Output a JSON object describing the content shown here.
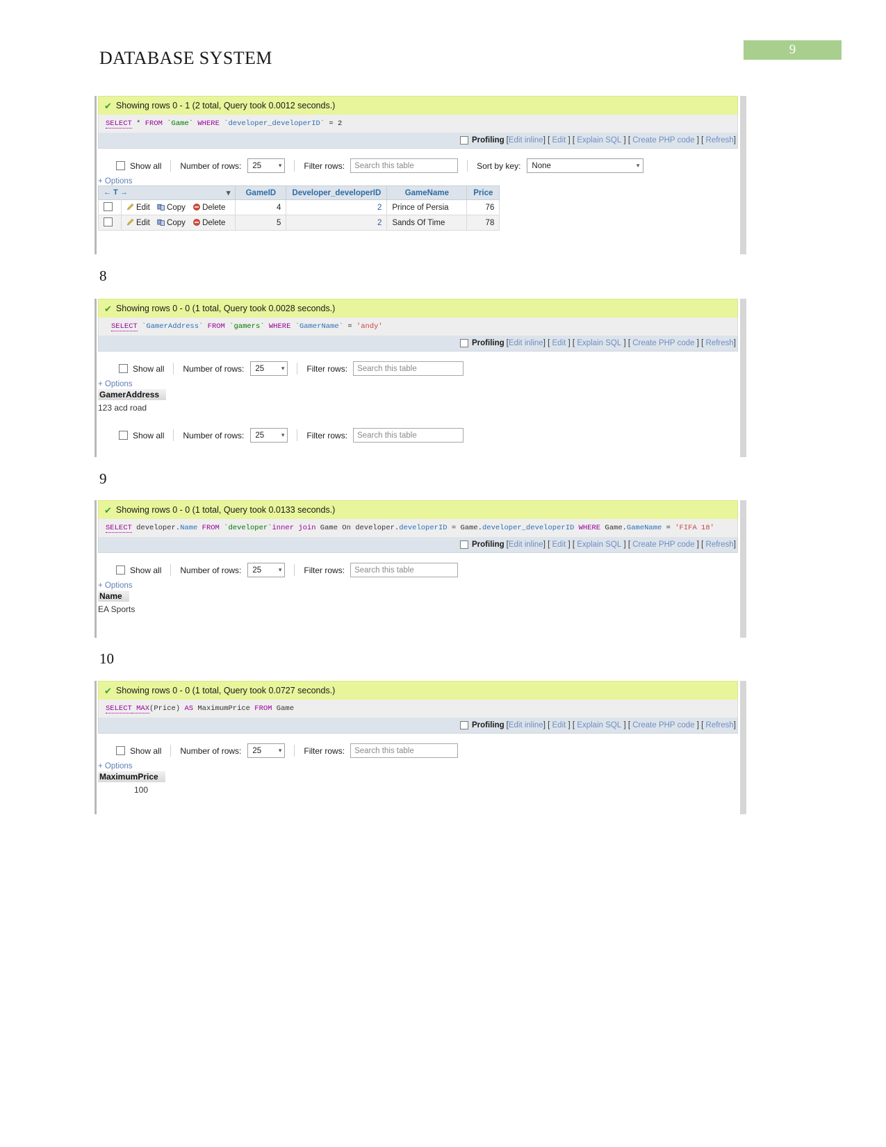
{
  "document": {
    "title": "DATABASE SYSTEM",
    "page_badge": "9"
  },
  "common": {
    "check_icon": "check-icon",
    "profiling_label": "Profiling",
    "links": {
      "edit_inline": "Edit inline",
      "edit": "Edit",
      "explain_sql": "Explain SQL",
      "create_php": "Create PHP code",
      "refresh": "Refresh"
    },
    "brackets": {
      "open": "[",
      "close": "]"
    },
    "controls": {
      "show_all": "Show all",
      "number_of_rows_label": "Number of rows:",
      "number_of_rows_value": "25",
      "filter_rows_label": "Filter rows:",
      "filter_placeholder": "Search this table",
      "sort_by_key_label": "Sort by key:",
      "sort_by_key_value": "None",
      "options": "+ Options"
    },
    "colors": {
      "success_bg": "#e8f59b",
      "badge_green": "#a8cf8e",
      "profiling_bg": "#dde3ea",
      "link_blue": "#6d8fc4"
    }
  },
  "panels": [
    {
      "id": "panel-7",
      "section_number": null,
      "status": "Showing rows 0 - 1 (2 total, Query took 0.0012 seconds.)",
      "sql_tokens": [
        {
          "t": "SELECT",
          "c": "kw-u"
        },
        {
          "t": " * ",
          "c": "plain"
        },
        {
          "t": "FROM",
          "c": "kw"
        },
        {
          "t": " `Game` ",
          "c": "tbl"
        },
        {
          "t": "WHERE",
          "c": "kw"
        },
        {
          "t": " `developer_developerID` ",
          "c": "col"
        },
        {
          "t": "= 2",
          "c": "num"
        }
      ],
      "has_sort_by_key": true,
      "result_type": "table",
      "table": {
        "nav_cell": "← T →",
        "headers": [
          "GameID",
          "Developer_developerID",
          "GameName",
          "Price"
        ],
        "row_actions": [
          "Edit",
          "Copy",
          "Delete"
        ],
        "rows": [
          {
            "GameID": "4",
            "Developer_developerID": "2",
            "GameName": "Prince of Persia",
            "Price": "76"
          },
          {
            "GameID": "5",
            "Developer_developerID": "2",
            "GameName": "Sands Of Time",
            "Price": "78"
          }
        ]
      }
    },
    {
      "id": "panel-8",
      "section_number": "8",
      "status": "Showing rows 0 - 0 (1 total, Query took 0.0028 seconds.)",
      "sql_tokens": [
        {
          "t": "SELECT",
          "c": "kw-u"
        },
        {
          "t": " `GamerAddress` ",
          "c": "col"
        },
        {
          "t": "FROM",
          "c": "kw"
        },
        {
          "t": " `gamers` ",
          "c": "tbl"
        },
        {
          "t": "WHERE",
          "c": "kw"
        },
        {
          "t": " `GamerName` ",
          "c": "col"
        },
        {
          "t": "= ",
          "c": "num"
        },
        {
          "t": "'andy'",
          "c": "str"
        }
      ],
      "has_sort_by_key": false,
      "result_type": "single",
      "single": {
        "column": "GamerAddress",
        "value": "123 acd road",
        "indent": false
      },
      "truncated_repeat": true
    },
    {
      "id": "panel-9",
      "section_number": "9",
      "status": "Showing rows 0 - 0 (1 total, Query took 0.0133 seconds.)",
      "sql_tokens": [
        {
          "t": "SELECT",
          "c": "kw-u"
        },
        {
          "t": " developer.",
          "c": "plain"
        },
        {
          "t": "Name",
          "c": "col"
        },
        {
          "t": " FROM",
          "c": "kw"
        },
        {
          "t": " `developer`",
          "c": "tbl"
        },
        {
          "t": "inner join",
          "c": "kw"
        },
        {
          "t": " Game On developer.",
          "c": "plain"
        },
        {
          "t": "developerID",
          "c": "col"
        },
        {
          "t": " = Game.",
          "c": "plain"
        },
        {
          "t": "developer_developerID",
          "c": "col"
        },
        {
          "t": " WHERE",
          "c": "kw"
        },
        {
          "t": " Game.",
          "c": "plain"
        },
        {
          "t": "GameName",
          "c": "col"
        },
        {
          "t": " = ",
          "c": "num"
        },
        {
          "t": "'FIFA 18'",
          "c": "str"
        }
      ],
      "has_sort_by_key": false,
      "result_type": "single",
      "single": {
        "column": "Name",
        "value": "EA Sports",
        "indent": false
      },
      "truncated_repeat": false
    },
    {
      "id": "panel-10",
      "section_number": "10",
      "status": "Showing rows 0 - 0 (1 total, Query took 0.0727 seconds.)",
      "sql_tokens": [
        {
          "t": "SELECT",
          "c": "kw-u"
        },
        {
          "t": " MAX",
          "c": "kw-u"
        },
        {
          "t": "(Price) ",
          "c": "plain"
        },
        {
          "t": "AS",
          "c": "kw"
        },
        {
          "t": " MaximumPrice ",
          "c": "plain"
        },
        {
          "t": "FROM",
          "c": "kw"
        },
        {
          "t": " Game",
          "c": "plain"
        }
      ],
      "has_sort_by_key": false,
      "result_type": "single",
      "single": {
        "column": "MaximumPrice",
        "value": "100",
        "indent": true
      },
      "truncated_repeat": false
    }
  ]
}
